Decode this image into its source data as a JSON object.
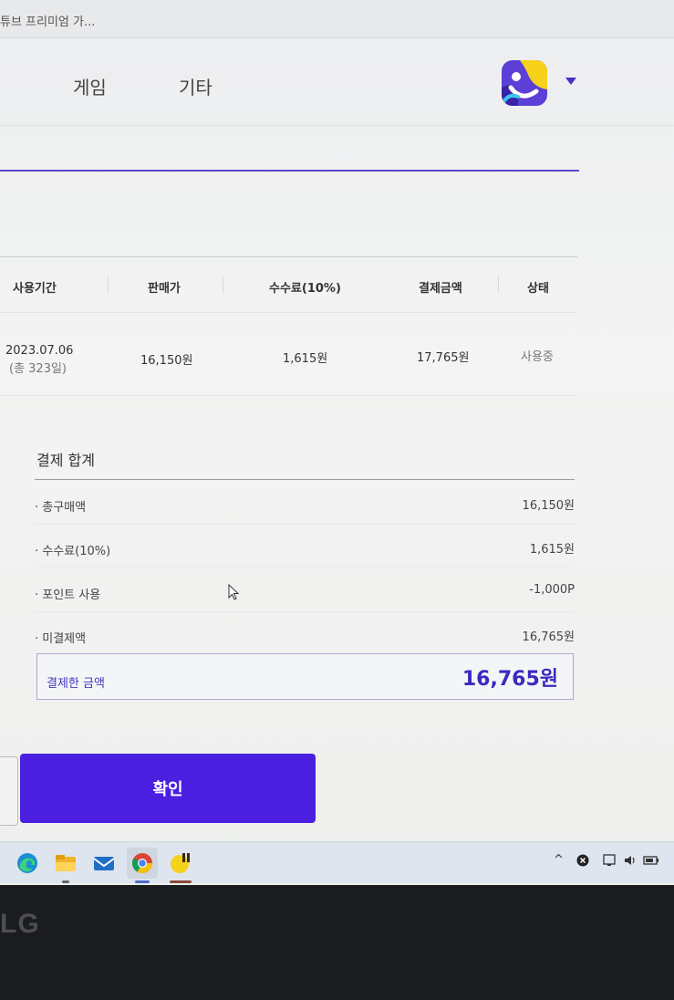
{
  "browser": {
    "tab_title": "튜브 프리미엄 가..."
  },
  "nav": {
    "items": [
      "게임",
      "기타"
    ]
  },
  "table": {
    "headers": [
      "사용기간",
      "판매가",
      "수수료(10%)",
      "결제금액",
      "상태"
    ],
    "row": {
      "date": "2023.07.06",
      "duration": "(총 323일)",
      "price": "16,150원",
      "fee": "1,615원",
      "payment": "17,765원",
      "status": "사용중"
    }
  },
  "summary": {
    "title": "결제 합계",
    "rows": [
      {
        "label": "· 총구매액",
        "value": "16,150원"
      },
      {
        "label": "· 수수료(10%)",
        "value": "1,615원"
      },
      {
        "label": "· 포인트 사용",
        "value": "-1,000P"
      },
      {
        "label": "· 미결제액",
        "value": "16,765원"
      }
    ],
    "paid_label": "결제한 금액",
    "paid_value": "16,765원"
  },
  "buttons": {
    "confirm": "확인"
  },
  "bezel": {
    "brand": "LG"
  },
  "colors": {
    "accent": "#4a1fe0",
    "accent_text": "#3b2ac0"
  }
}
